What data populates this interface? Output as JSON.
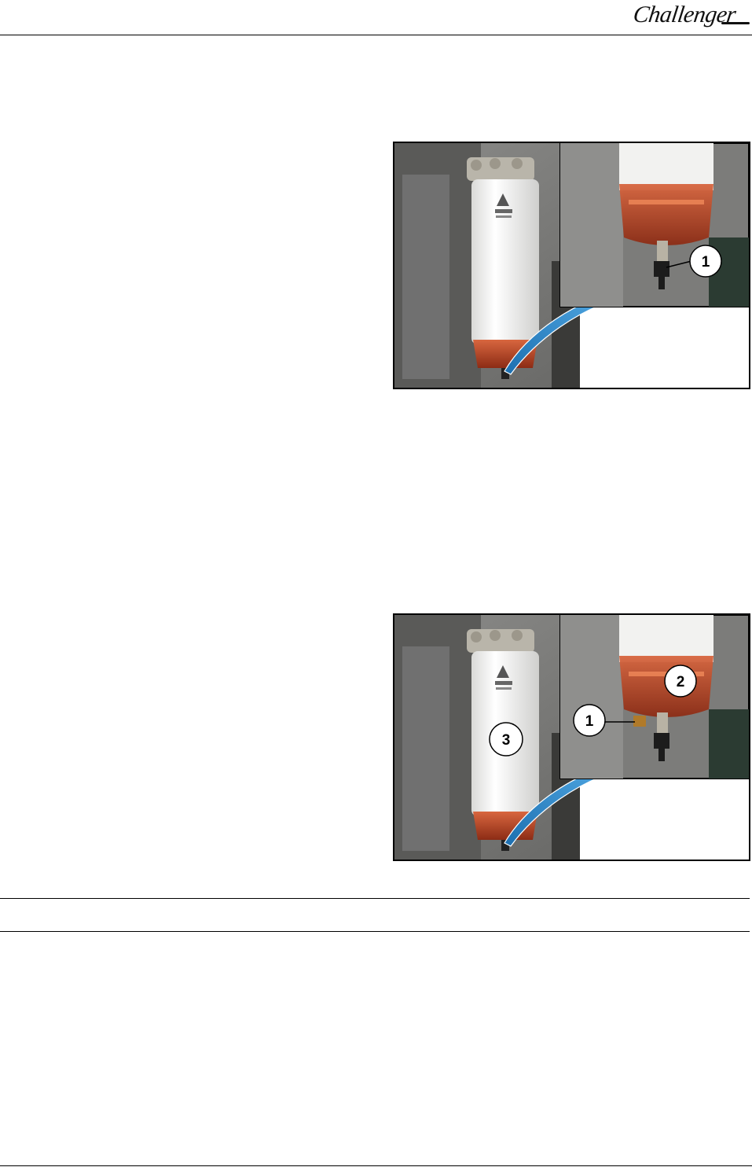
{
  "header": {
    "brand": "Challenger"
  },
  "figures": [
    {
      "callouts": [
        "1"
      ]
    },
    {
      "callouts": [
        "2",
        "1",
        "3"
      ]
    }
  ],
  "colors": {
    "bowl": "#c2452a",
    "arrow": "#2f8fd3",
    "wall": "#6d6d6b",
    "filter": "#f3f3f1"
  }
}
